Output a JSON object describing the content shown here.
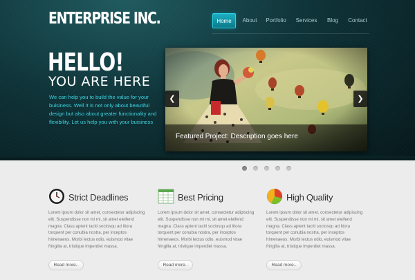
{
  "brand": {
    "logo": "ENTERPRISE INC."
  },
  "nav": {
    "items": [
      "Home",
      "About",
      "Portfolio",
      "Services",
      "Blog",
      "Contact"
    ],
    "active": "Home"
  },
  "hero": {
    "headline": "HELLO!",
    "subheadline": "YOU ARE HERE",
    "intro": "We can help you to build the value for your buisiness. Well It is not only about beautiful design but also about greater functionality and flexibility. Let us help you with your buisiness"
  },
  "slider": {
    "caption": "Featured Project: Description goes here",
    "prev_icon": "chevron-left-icon",
    "next_icon": "chevron-right-icon",
    "dots_count": 5,
    "active_dot": 0
  },
  "features": [
    {
      "icon": "clock-icon",
      "title": "Strict Deadlines",
      "text": "Lorem ipsum dolor sit amet, consectetur adipiscing elit. Suspendisse non mi mi, sit amet eleifend magna. Class aptent taciti sociosqu ad litora torquent per conubia nostra, per inceptos himenaeos. Morbi lectus odio, euismod vitae fringilla at, tristique imperdiet massa.",
      "button": "Read more.."
    },
    {
      "icon": "spreadsheet-icon",
      "title": "Best Pricing",
      "text": "Lorem ipsum dolor sit amet, consectetur adipiscing elit. Suspendisse non mi mi, sit amet eleifend magna. Class aptent taciti sociosqu ad litora torquent per conubia nostra, per inceptos himenaeos. Morbi lectus odio, euismod vitae fringilla at, tristique imperdiet massa.",
      "button": "Read more.."
    },
    {
      "icon": "pie-chart-icon",
      "title": "High Quality",
      "text": "Lorem ipsum dolor sit amet, consectetur adipiscing elit. Suspendisse non mi mi, sit amet eleifend magna. Class aptent taciti sociosqu ad litora torquent per conubia nostra, per inceptos himenaeos. Morbi lectus odio, euismod vitae fringilla at, tristique imperdiet massa.",
      "button": "Read more.."
    }
  ],
  "colors": {
    "accent": "#1cb0c2",
    "intro_text": "#3fd2df",
    "hero_dark": "#06181b"
  }
}
